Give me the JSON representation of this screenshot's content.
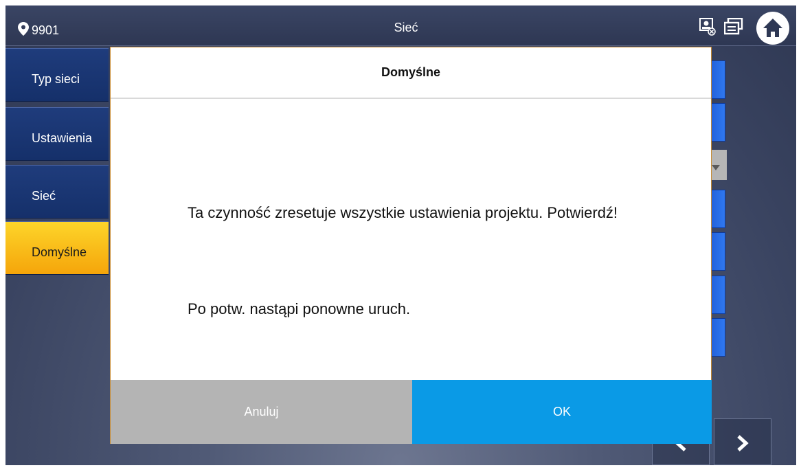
{
  "header": {
    "location_id": "9901",
    "title": "Sieć",
    "icons": [
      "location-pin-icon",
      "contacts-status-icon",
      "message-icon",
      "home-icon"
    ]
  },
  "sidebar": {
    "items": [
      {
        "label": "Typ sieci",
        "active": false
      },
      {
        "label": "Ustawienia",
        "active": false
      },
      {
        "label": "Sieć",
        "active": false
      },
      {
        "label": "Domyślne",
        "active": true
      }
    ]
  },
  "pagination": {
    "prev_icon": "chevron-left-icon",
    "next_icon": "chevron-right-icon"
  },
  "dialog": {
    "title": "Domyślne",
    "message": "Ta czynność zresetuje wszystkie ustawienia projektu. Potwierdź!",
    "note": "Po potw. nastąpi ponowne uruch.",
    "cancel_label": "Anuluj",
    "ok_label": "OK"
  },
  "colors": {
    "accent_active": "#f5b400",
    "ok_button": "#0a9ae6",
    "cancel_button": "#b4b4b4",
    "sidebar": "#1a3572"
  }
}
